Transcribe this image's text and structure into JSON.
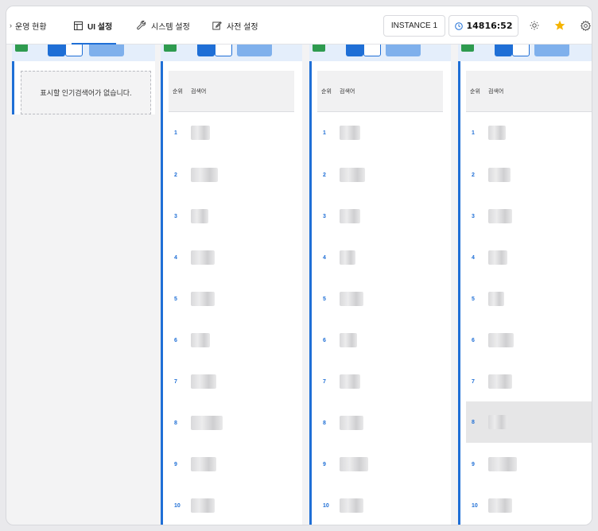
{
  "nav": {
    "items": [
      {
        "label": "운영 현황",
        "icon": "chevron-right-icon"
      },
      {
        "label": "UI 설정",
        "icon": "layout-icon",
        "active": true
      },
      {
        "label": "시스템 설정",
        "icon": "wrench-icon"
      },
      {
        "label": "사전 설정",
        "icon": "edit-icon"
      }
    ],
    "instance_label": "INSTANCE 1",
    "clock": "14816:52",
    "right_icons": [
      "sun-icon",
      "star-icon",
      "gear-icon"
    ],
    "accent": "#1f6fd6",
    "star_color": "#f5b400"
  },
  "empty_message": "표시할 인기검색어가 없습니다.",
  "table": {
    "rank_header": "순위",
    "keyword_header": "검색어",
    "ranks": [
      "1",
      "2",
      "3",
      "4",
      "5",
      "6",
      "7",
      "8",
      "9",
      "10"
    ]
  }
}
